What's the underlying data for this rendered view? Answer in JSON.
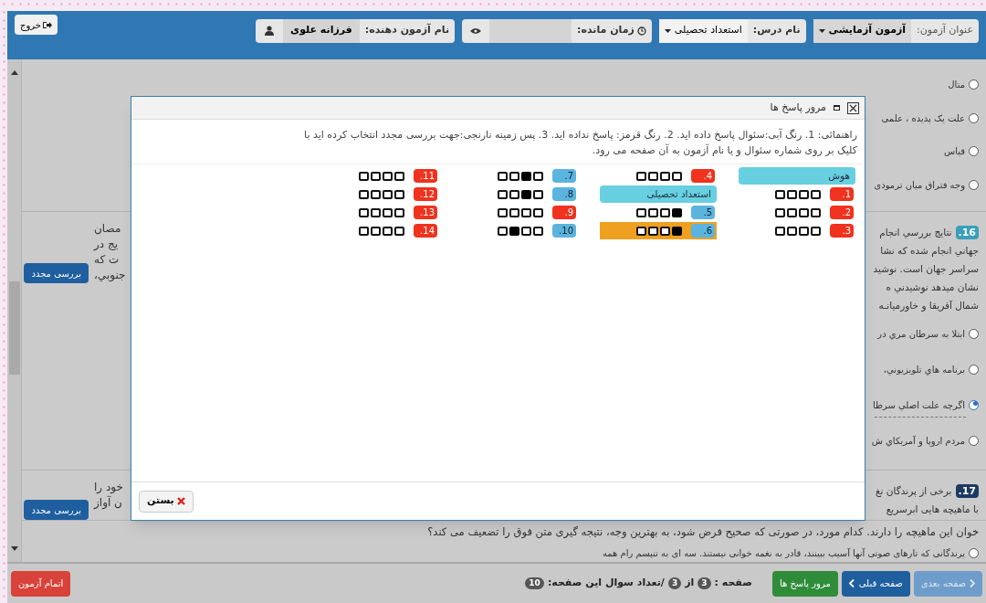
{
  "header": {
    "exam_title_label": "عنوان آزمون:",
    "exam_title": "آزمون آزمایشی",
    "subject_label": "نام درس:",
    "subject": "استعداد تحصیلی",
    "time_label": "زمان مانده:",
    "examinee_label": "نام آزمون دهنده:",
    "examinee": "فرزانه علوی",
    "exit": "خروج"
  },
  "background": {
    "sections": [
      {
        "options": [
          {
            "text": "متال",
            "selected": false
          },
          {
            "text": "علت یک پدیده ، علمی",
            "selected": false
          },
          {
            "text": "قیاس",
            "selected": false
          },
          {
            "text": "وجه فتراق میان ترمودی",
            "selected": false
          }
        ]
      },
      {
        "number": "16.",
        "answered": true,
        "lines": [
          "نتایج بررسي انجام",
          "جهاني انجام شده كه نشا",
          "سراسر جهان است. نوشيد",
          "نشان ميدهد نوشيدني ه",
          "شمال آفريقا و خاورميانـه"
        ],
        "left_fragments": [
          "مصان",
          "يج در",
          "ت كه",
          "جنوبي،"
        ],
        "review_button": "بررسی مجدد",
        "options": [
          {
            "text": "ابتلا به سرطان مري در",
            "selected": false
          },
          {
            "text": "برنامه هاي تلويزيوني،",
            "selected": false
          },
          {
            "text": "اگرچه علت اصلي سرطا",
            "selected": true
          },
          {
            "text": "مردم اروپا و آمريكاي ش",
            "selected": false
          }
        ]
      },
      {
        "number": "17.",
        "answered": false,
        "lines": [
          "برخی از پرندگان نغ",
          "با ماهیچه هایی ابرسریع"
        ],
        "left_fragments": [
          "خود را",
          "ن آواز"
        ],
        "review_button": "بررسی مجدد"
      }
    ],
    "bottom_line": "خوان این ماهیچه را دارند. کدام مورد، در صورتی که صحیح فرض شود، به بهترین وجه، نتیجه گیری متن فوق را تضعیف می کند؟",
    "bottom_option": {
      "text": "پرندگانی که تارهای صوتی آنها آسیب ببینند، قادر به نغمه خوانی نیستند. سه ای به تنیسم رام همه",
      "selected": false
    }
  },
  "dialog": {
    "title": "مرور پاسخ ها",
    "instructions": "راهنمائی: 1. رنگ آبی:سئوال پاسخ داده اید. 2. رنگ قرمز: پاسخ نداده اید. 3. پس زمینه نارنجی:جهت بررسی مجدد انتخاب کرده اید با کلیک بر روی شماره سئوال و یا نام آزمون به آن صفحه می رود.",
    "items": [
      {
        "kind": "header",
        "label": "هوش"
      },
      {
        "kind": "question",
        "number": "1.",
        "answered": false,
        "review": false,
        "choices": [
          false,
          false,
          false,
          false
        ]
      },
      {
        "kind": "question",
        "number": "2.",
        "answered": false,
        "review": false,
        "choices": [
          false,
          false,
          false,
          false
        ]
      },
      {
        "kind": "question",
        "number": "3.",
        "answered": false,
        "review": false,
        "choices": [
          false,
          false,
          false,
          false
        ]
      },
      {
        "kind": "question",
        "number": "4.",
        "answered": false,
        "review": false,
        "choices": [
          false,
          false,
          false,
          false
        ]
      },
      {
        "kind": "header",
        "label": "استعداد تحصیلی"
      },
      {
        "kind": "question",
        "number": "5.",
        "answered": true,
        "review": false,
        "choices": [
          true,
          false,
          false,
          false
        ]
      },
      {
        "kind": "question",
        "number": "6.",
        "answered": true,
        "review": true,
        "choices": [
          true,
          false,
          false,
          false
        ]
      },
      {
        "kind": "question",
        "number": "7.",
        "answered": true,
        "review": false,
        "choices": [
          false,
          true,
          false,
          false
        ]
      },
      {
        "kind": "question",
        "number": "8.",
        "answered": true,
        "review": false,
        "choices": [
          false,
          true,
          false,
          false
        ]
      },
      {
        "kind": "question",
        "number": "9.",
        "answered": false,
        "review": false,
        "choices": [
          false,
          false,
          false,
          false
        ]
      },
      {
        "kind": "question",
        "number": "10.",
        "answered": true,
        "review": false,
        "choices": [
          false,
          false,
          true,
          false
        ]
      },
      {
        "kind": "question",
        "number": "11.",
        "answered": false,
        "review": false,
        "choices": [
          false,
          false,
          false,
          false
        ]
      },
      {
        "kind": "question",
        "number": "12.",
        "answered": false,
        "review": false,
        "choices": [
          false,
          false,
          false,
          false
        ]
      },
      {
        "kind": "question",
        "number": "13.",
        "answered": false,
        "review": false,
        "choices": [
          false,
          false,
          false,
          false
        ]
      },
      {
        "kind": "question",
        "number": "14.",
        "answered": false,
        "review": false,
        "choices": [
          false,
          false,
          false,
          false
        ]
      }
    ],
    "close": "بستن"
  },
  "footer": {
    "next": "صفحه بعدی",
    "previous": "صفحه قبلی",
    "review": "مرور پاسخ ها",
    "page_label": "صفحه :",
    "page": "3",
    "of": "از",
    "pages": "3",
    "count_label": "/تعداد سوال این صفحه:",
    "count": "10",
    "finish": "اتمام آزمون"
  }
}
